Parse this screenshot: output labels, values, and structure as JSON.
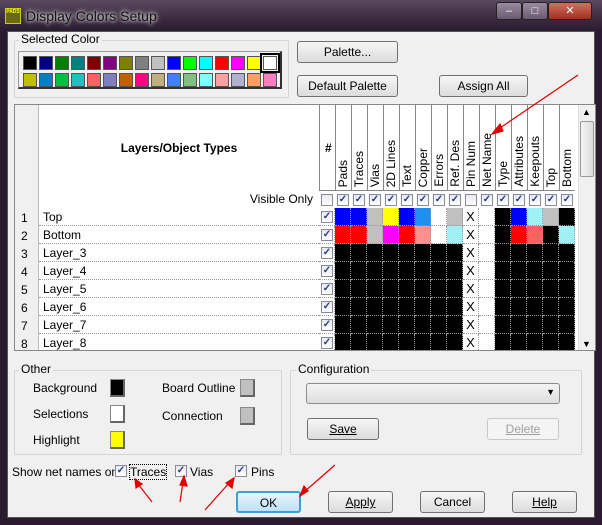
{
  "window": {
    "title": "Display Colors Setup",
    "icon_text": "PADS"
  },
  "selected_color": {
    "label": "Selected Color",
    "row1": [
      "#000000",
      "#000080",
      "#008000",
      "#008080",
      "#800000",
      "#800080",
      "#808000",
      "#808080",
      "#c0c0c0",
      "#0000ff",
      "#00ff00",
      "#00ffff",
      "#ff0000",
      "#ff00ff",
      "#ffff00",
      "#ffffff"
    ],
    "row2": [
      "#c0c000",
      "#0080c0",
      "#00c040",
      "#20c0c0",
      "#ff6060",
      "#8080c0",
      "#c06000",
      "#ff0080",
      "#c0b080",
      "#4080ff",
      "#80c080",
      "#80ffff",
      "#ffa0a0",
      "#b0b0d0",
      "#ffa060",
      "#ff80c0"
    ],
    "selected_index": 15
  },
  "buttons": {
    "palette": "Palette...",
    "default_palette": "Default Palette",
    "assign_all": "Assign All",
    "save": "Save",
    "delete": "Delete",
    "ok": "OK",
    "apply": "Apply",
    "cancel": "Cancel",
    "help": "Help"
  },
  "grid": {
    "header_title": "Layers/Object Types",
    "hash": "#",
    "visible_only": "Visible Only",
    "columns": [
      "Pads",
      "Traces",
      "Vias",
      "2D Lines",
      "Text",
      "Copper",
      "Errors",
      "Ref. Des",
      "Pin Num",
      "Net Name",
      "Type",
      "Attributes",
      "Keepouts",
      "Top",
      "Bottom"
    ],
    "visible_only_checks": [
      true,
      true,
      true,
      true,
      true,
      true,
      true,
      true,
      false,
      true,
      true,
      true,
      true,
      true,
      true
    ],
    "hash_visible_check": false,
    "rows": [
      {
        "num": "1",
        "name": "Top",
        "checked": true,
        "colors": [
          "#0000ff",
          "#0000ff",
          "#c0c0c0",
          "#ffff00",
          "#0000ff",
          "#2090f0",
          "#ffffff",
          "#c0c0c0",
          "X",
          "#ffffff",
          "#000000",
          "#0000ff",
          "#a0f0f8",
          "#c0c0c0",
          "#000000"
        ]
      },
      {
        "num": "2",
        "name": "Bottom",
        "checked": true,
        "colors": [
          "#ff0000",
          "#ff0000",
          "#c0c0c0",
          "#ff00ff",
          "#ff0000",
          "#ff9090",
          "#ffffff",
          "#a0f0f8",
          "X",
          "#ffffff",
          "#000000",
          "#ff0000",
          "#ff6060",
          "#000000",
          "#a0f0f8"
        ]
      },
      {
        "num": "3",
        "name": "Layer_3",
        "checked": true,
        "colors": [
          "#000000",
          "#000000",
          "#000000",
          "#000000",
          "#000000",
          "#000000",
          "#000000",
          "#000000",
          "X",
          "#ffffff",
          "#000000",
          "#000000",
          "#000000",
          "#000000",
          "#000000"
        ]
      },
      {
        "num": "4",
        "name": "Layer_4",
        "checked": true,
        "colors": [
          "#000000",
          "#000000",
          "#000000",
          "#000000",
          "#000000",
          "#000000",
          "#000000",
          "#000000",
          "X",
          "#ffffff",
          "#000000",
          "#000000",
          "#000000",
          "#000000",
          "#000000"
        ]
      },
      {
        "num": "5",
        "name": "Layer_5",
        "checked": true,
        "colors": [
          "#000000",
          "#000000",
          "#000000",
          "#000000",
          "#000000",
          "#000000",
          "#000000",
          "#000000",
          "X",
          "#ffffff",
          "#000000",
          "#000000",
          "#000000",
          "#000000",
          "#000000"
        ]
      },
      {
        "num": "6",
        "name": "Layer_6",
        "checked": true,
        "colors": [
          "#000000",
          "#000000",
          "#000000",
          "#000000",
          "#000000",
          "#000000",
          "#000000",
          "#000000",
          "X",
          "#ffffff",
          "#000000",
          "#000000",
          "#000000",
          "#000000",
          "#000000"
        ]
      },
      {
        "num": "7",
        "name": "Layer_7",
        "checked": true,
        "colors": [
          "#000000",
          "#000000",
          "#000000",
          "#000000",
          "#000000",
          "#000000",
          "#000000",
          "#000000",
          "X",
          "#ffffff",
          "#000000",
          "#000000",
          "#000000",
          "#000000",
          "#000000"
        ]
      },
      {
        "num": "8",
        "name": "Layer_8",
        "checked": true,
        "colors": [
          "#000000",
          "#000000",
          "#000000",
          "#000000",
          "#000000",
          "#000000",
          "#000000",
          "#000000",
          "X",
          "#ffffff",
          "#000000",
          "#000000",
          "#000000",
          "#000000",
          "#000000"
        ]
      }
    ]
  },
  "other": {
    "label": "Other",
    "background": "Background",
    "background_color": "#000000",
    "selections": "Selections",
    "selections_color": "#ffffff",
    "highlight": "Highlight",
    "highlight_color": "#ffff00",
    "board_outline": "Board Outline",
    "board_outline_color": "#c0c0c0",
    "connection": "Connection",
    "connection_color": "#c0c0c0"
  },
  "configuration": {
    "label": "Configuration",
    "value": ""
  },
  "net_names": {
    "label": "Show net names on",
    "traces": "Traces",
    "vias": "Vias",
    "pins": "Pins",
    "traces_checked": true,
    "vias_checked": true,
    "pins_checked": true
  }
}
